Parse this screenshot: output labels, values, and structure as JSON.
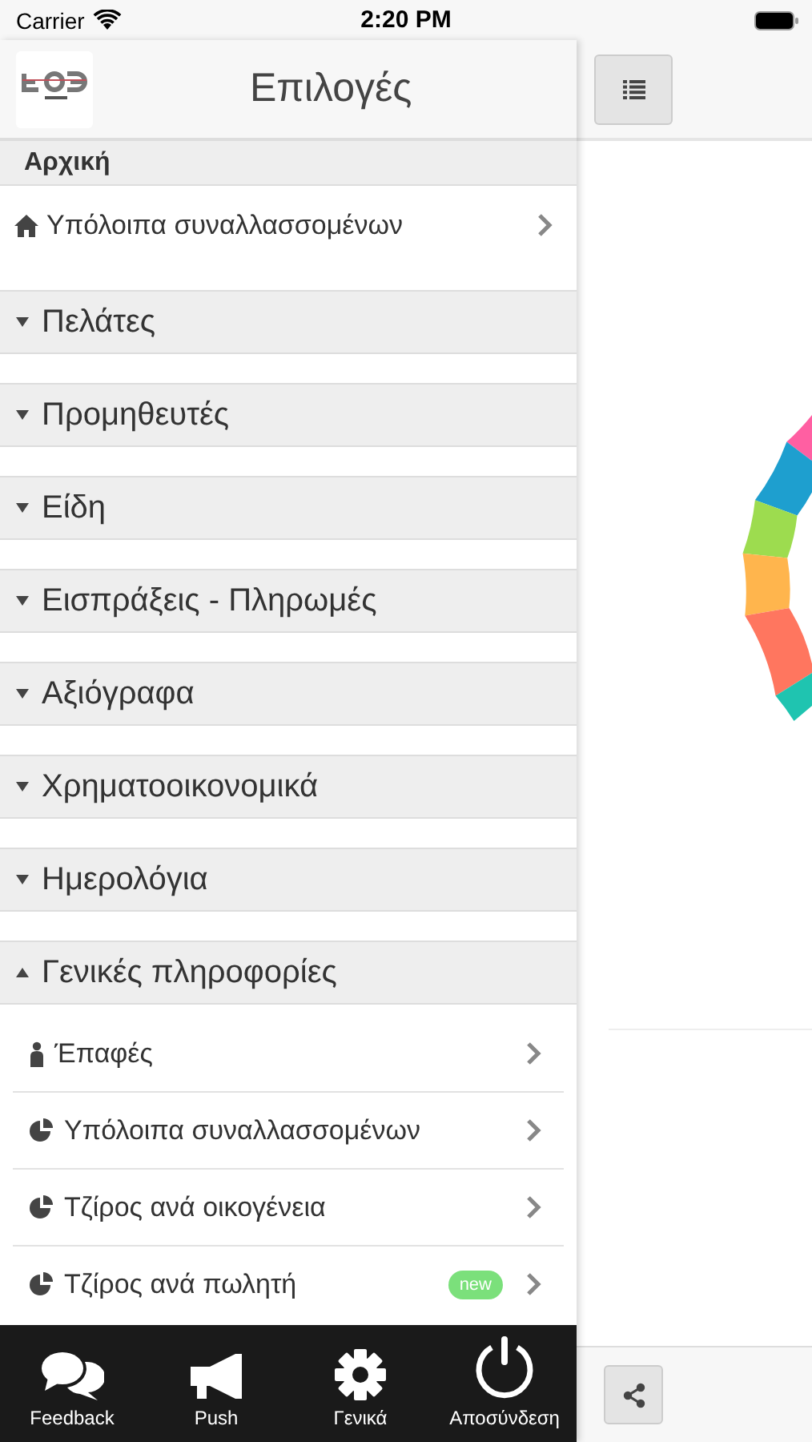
{
  "status_bar": {
    "carrier": "Carrier",
    "time": "2:20 PM"
  },
  "header": {
    "title": "Επιλογές"
  },
  "home_section": {
    "title": "Αρχική",
    "items": [
      {
        "label": "Υπόλοιπα συναλλασσομένων",
        "kind": "home"
      }
    ]
  },
  "groups": [
    {
      "label": "Πελάτες",
      "expanded": false
    },
    {
      "label": "Προμηθευτές",
      "expanded": false
    },
    {
      "label": "Είδη",
      "expanded": false
    },
    {
      "label": "Εισπράξεις - Πληρωμές",
      "expanded": false
    },
    {
      "label": "Αξιόγραφα",
      "expanded": false
    },
    {
      "label": "Χρηματοοικονομικά",
      "expanded": false
    },
    {
      "label": "Ημερολόγια",
      "expanded": false
    },
    {
      "label": "Γενικές πληροφορίες",
      "expanded": true,
      "items": [
        {
          "label": "Έπαφές",
          "kind": "person"
        },
        {
          "label": "Υπόλοιπα συναλλασσομένων",
          "kind": "pie"
        },
        {
          "label": "Τζίρος ανά οικογένεια",
          "kind": "pie"
        },
        {
          "label": "Τζίρος ανά πωλητή",
          "kind": "pie",
          "badge": "new"
        }
      ]
    }
  ],
  "tab_bar": [
    {
      "label": "Feedback",
      "kind": "chat"
    },
    {
      "label": "Push",
      "kind": "megaphone"
    },
    {
      "label": "Γενικά",
      "kind": "gear"
    },
    {
      "label": "Αποσύνδεση",
      "kind": "power"
    }
  ]
}
